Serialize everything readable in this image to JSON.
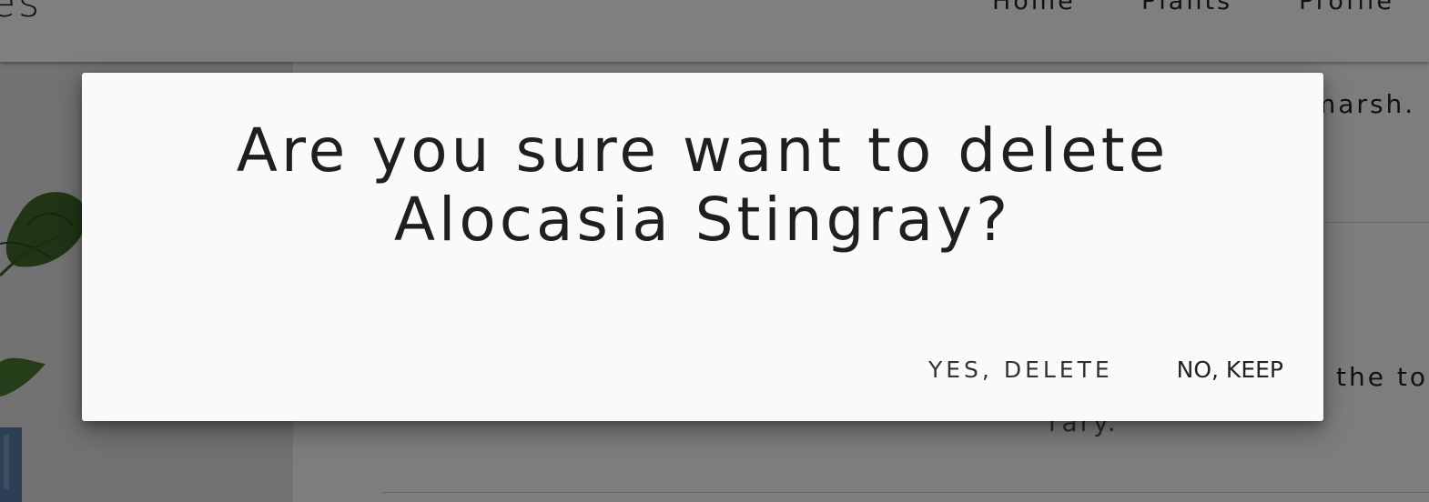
{
  "header": {
    "brand": "es",
    "nav": [
      {
        "label": "Home"
      },
      {
        "label": "Plants"
      },
      {
        "label": "Profile"
      }
    ]
  },
  "content": {
    "line_1": "marsh.",
    "line_2": "the to",
    "line_3": "rary."
  },
  "dialog": {
    "title_line_1": "Are you sure want to delete",
    "title_line_2": "Alocasia Stingray?",
    "confirm_label": "YES, DELETE",
    "cancel_label": "NO, KEEP"
  }
}
